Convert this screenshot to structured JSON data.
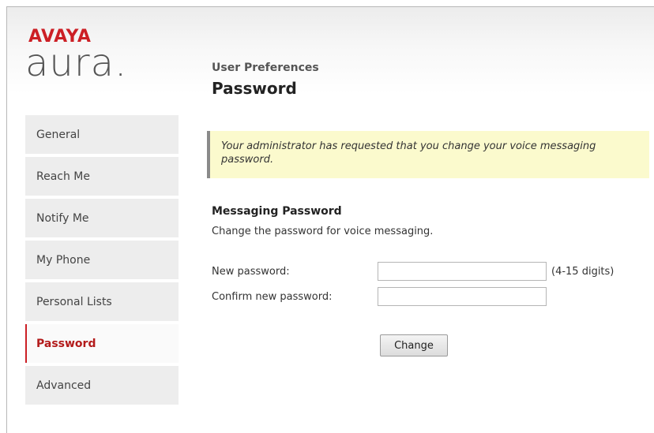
{
  "logo": {
    "brand": "AVAYA",
    "product": "aura",
    "product_suffix": "."
  },
  "sidebar": {
    "items": [
      {
        "label": "General"
      },
      {
        "label": "Reach Me"
      },
      {
        "label": "Notify Me"
      },
      {
        "label": "My Phone"
      },
      {
        "label": "Personal Lists"
      },
      {
        "label": "Password",
        "active": true
      },
      {
        "label": "Advanced"
      }
    ]
  },
  "main": {
    "section_label": "User Preferences",
    "title": "Password",
    "notice": "Your administrator has requested that you change your voice messaging password.",
    "messaging": {
      "heading": "Messaging Password",
      "description": "Change the password for voice messaging.",
      "new_password_label": "New password:",
      "new_password_value": "",
      "new_password_hint": "(4-15 digits)",
      "confirm_password_label": "Confirm new password:",
      "confirm_password_value": "",
      "change_button": "Change"
    }
  },
  "colors": {
    "brand_red": "#cc1f25",
    "notice_bg": "#fbfacd",
    "nav_bg": "#ededed"
  }
}
